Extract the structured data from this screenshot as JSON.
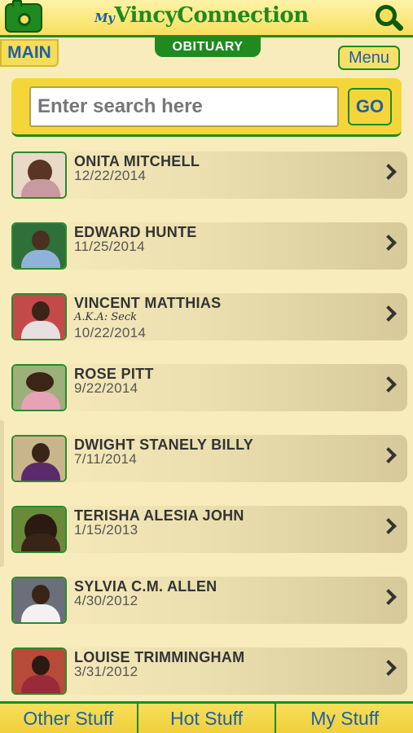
{
  "header": {
    "logo_prefix": "My",
    "logo_main": "Vincy",
    "logo_suffix": "Connection"
  },
  "nav": {
    "main_label": "MAIN",
    "section_label": "OBITUARY",
    "menu_label": "Menu"
  },
  "search": {
    "placeholder": "Enter search here",
    "go_label": "GO"
  },
  "obituaries": [
    {
      "name": "ONITA MITCHELL",
      "aka": "",
      "date": "12/22/2014"
    },
    {
      "name": "EDWARD HUNTE",
      "aka": "",
      "date": "11/25/2014"
    },
    {
      "name": "VINCENT MATTHIAS",
      "aka": "A.K.A: Seck",
      "date": "10/22/2014"
    },
    {
      "name": "ROSE PITT",
      "aka": "",
      "date": "9/22/2014"
    },
    {
      "name": "DWIGHT STANELY BILLY",
      "aka": "",
      "date": "7/11/2014"
    },
    {
      "name": "TERISHA ALESIA JOHN",
      "aka": "",
      "date": "1/15/2013"
    },
    {
      "name": "SYLVIA C.M. ALLEN",
      "aka": "",
      "date": "4/30/2012"
    },
    {
      "name": "LOUISE TRIMMINGHAM",
      "aka": "",
      "date": "3/31/2012"
    }
  ],
  "bottom_nav": [
    "Other Stuff",
    "Hot Stuff",
    "My Stuff"
  ],
  "colors": {
    "brand_green": "#1f8a1f",
    "brand_yellow": "#f5d63a",
    "link_blue": "#1f5fa8",
    "background": "#f8ecbd"
  }
}
